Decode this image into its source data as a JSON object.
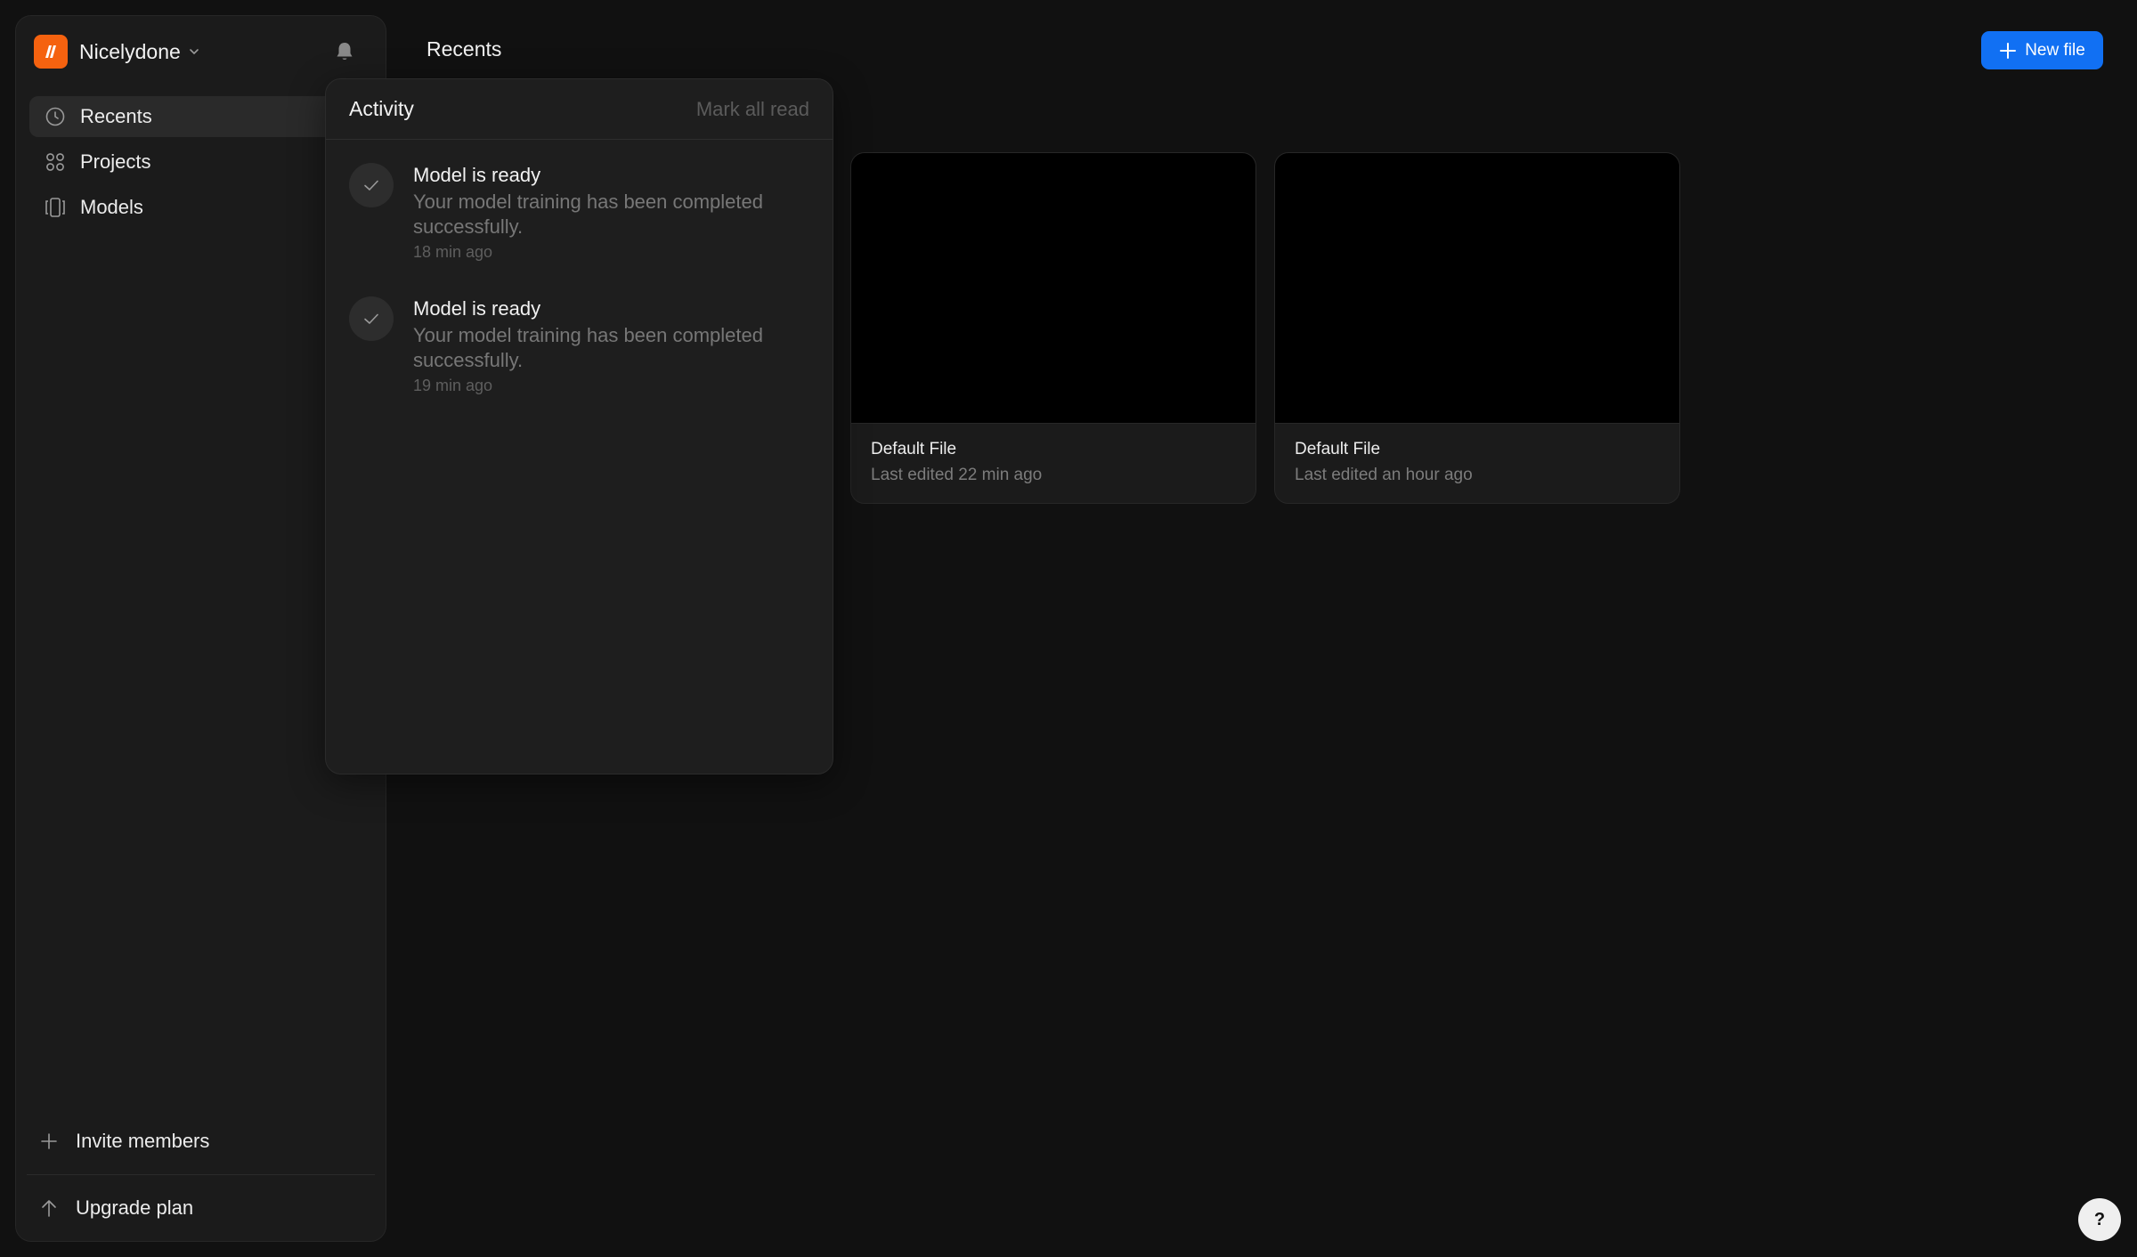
{
  "workspace": {
    "name": "Nicelydone",
    "logo_color": "#f5620f"
  },
  "sidebar": {
    "items": [
      {
        "label": "Recents",
        "icon": "clock-icon",
        "active": true
      },
      {
        "label": "Projects",
        "icon": "grid-icon",
        "active": false
      },
      {
        "label": "Models",
        "icon": "models-icon",
        "active": false
      }
    ],
    "bottom": {
      "invite_label": "Invite members",
      "upgrade_label": "Upgrade plan"
    }
  },
  "header": {
    "title": "Recents",
    "new_file_label": "New file",
    "accent_color": "#1170f3"
  },
  "activity": {
    "title": "Activity",
    "mark_all_read": "Mark all read",
    "notifications": [
      {
        "title": "Model is ready",
        "body": "Your model training has been completed successfully.",
        "time": "18 min ago"
      },
      {
        "title": "Model is ready",
        "body": "Your model training has been completed successfully.",
        "time": "19 min ago"
      }
    ]
  },
  "files": [
    {
      "name": "Default File",
      "meta": "Last edited 22 min ago"
    },
    {
      "name": "Default File",
      "meta": "Last edited an hour ago"
    }
  ],
  "help": {
    "label": "?"
  }
}
